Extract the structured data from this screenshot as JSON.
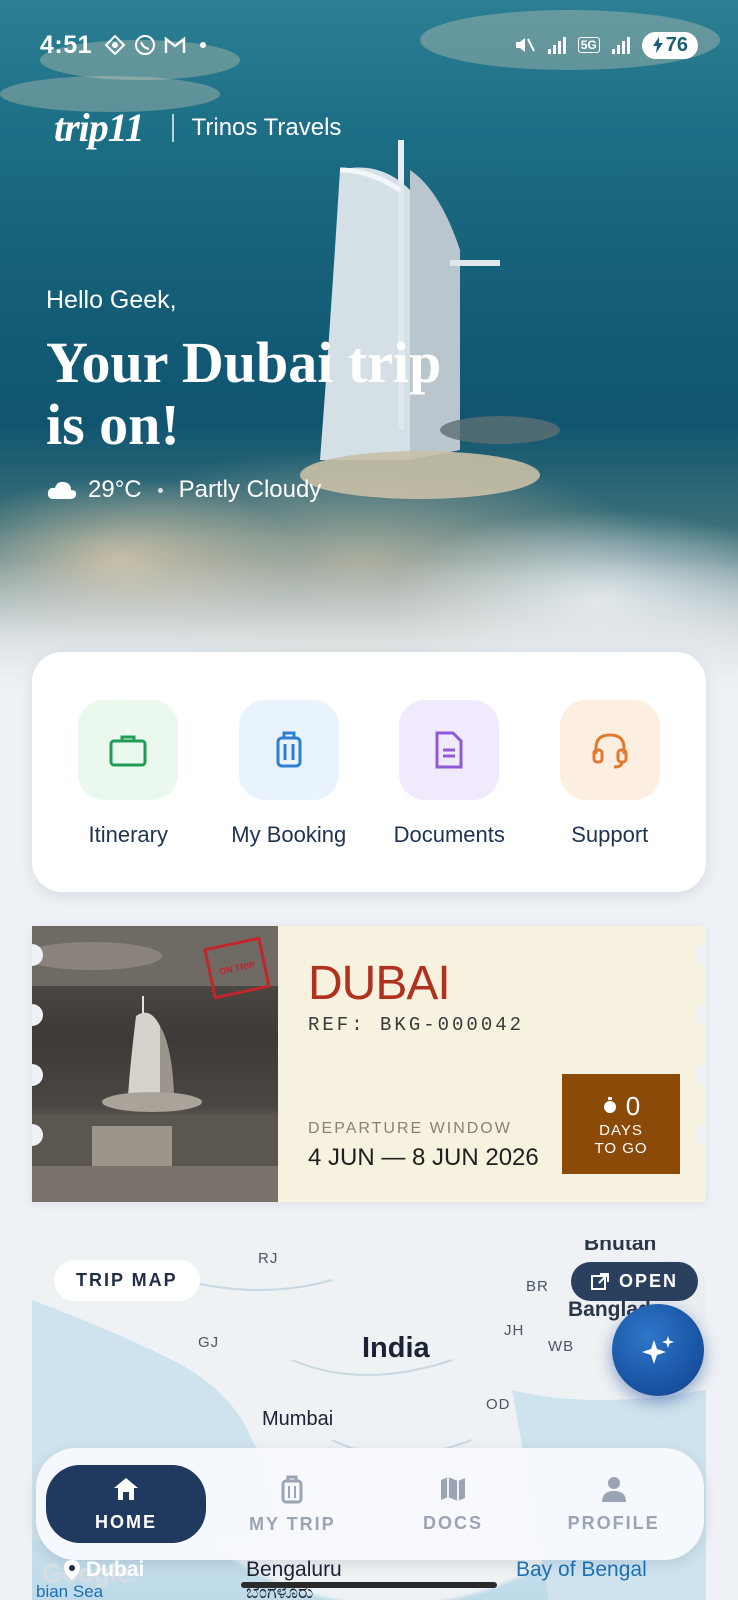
{
  "status_bar": {
    "time": "4:51",
    "battery": "76",
    "network": "5G"
  },
  "brand": {
    "logo": "trip11",
    "agency": "Trinos Travels"
  },
  "hero": {
    "greeting": "Hello Geek,",
    "headline_line1": "Your Dubai trip",
    "headline_line2": "is on!",
    "temperature": "29°C",
    "condition": "Partly Cloudy"
  },
  "quick_actions": [
    {
      "label": "Itinerary",
      "icon": "briefcase-icon",
      "color": "#1f9d55",
      "bg": "#eaf8ee"
    },
    {
      "label": "My Booking",
      "icon": "luggage-icon",
      "color": "#2f7fd1",
      "bg": "#e9f3fd"
    },
    {
      "label": "Documents",
      "icon": "document-icon",
      "color": "#8e5bd6",
      "bg": "#f0eafc"
    },
    {
      "label": "Support",
      "icon": "headset-icon",
      "color": "#e07b2e",
      "bg": "#fdeee2"
    }
  ],
  "ticket": {
    "destination": "DUBAI",
    "reference": "REF: BKG-000042",
    "stamp": "ON TRIP",
    "departure_label": "DEPARTURE WINDOW",
    "departure_dates": "4 JUN — 8 JUN 2026",
    "days_count": "0",
    "days_label_1": "DAYS",
    "days_label_2": "TO GO",
    "accent": "#b1311f",
    "countdown_bg": "#8b4a08"
  },
  "map": {
    "chip": "TRIP MAP",
    "open_label": "OPEN",
    "country": "India",
    "labels": {
      "rj": "RJ",
      "gj": "GJ",
      "br": "BR",
      "jh": "JH",
      "wb": "WB",
      "od": "OD",
      "bhutan": "Bhutan",
      "bangladesh": "Banglad",
      "mumbai": "Mumbai",
      "bengaluru": "Bengaluru",
      "bengaluru_kn": "ಬೆಂಗಳೂರು",
      "bay": "Bay of Bengal",
      "sea": "bian Sea",
      "google": "Google",
      "pin": "Dubai"
    }
  },
  "nav": [
    {
      "label": "HOME",
      "icon": "home-icon"
    },
    {
      "label": "MY TRIP",
      "icon": "luggage-icon"
    },
    {
      "label": "DOCS",
      "icon": "map-fold-icon"
    },
    {
      "label": "PROFILE",
      "icon": "person-icon"
    }
  ]
}
